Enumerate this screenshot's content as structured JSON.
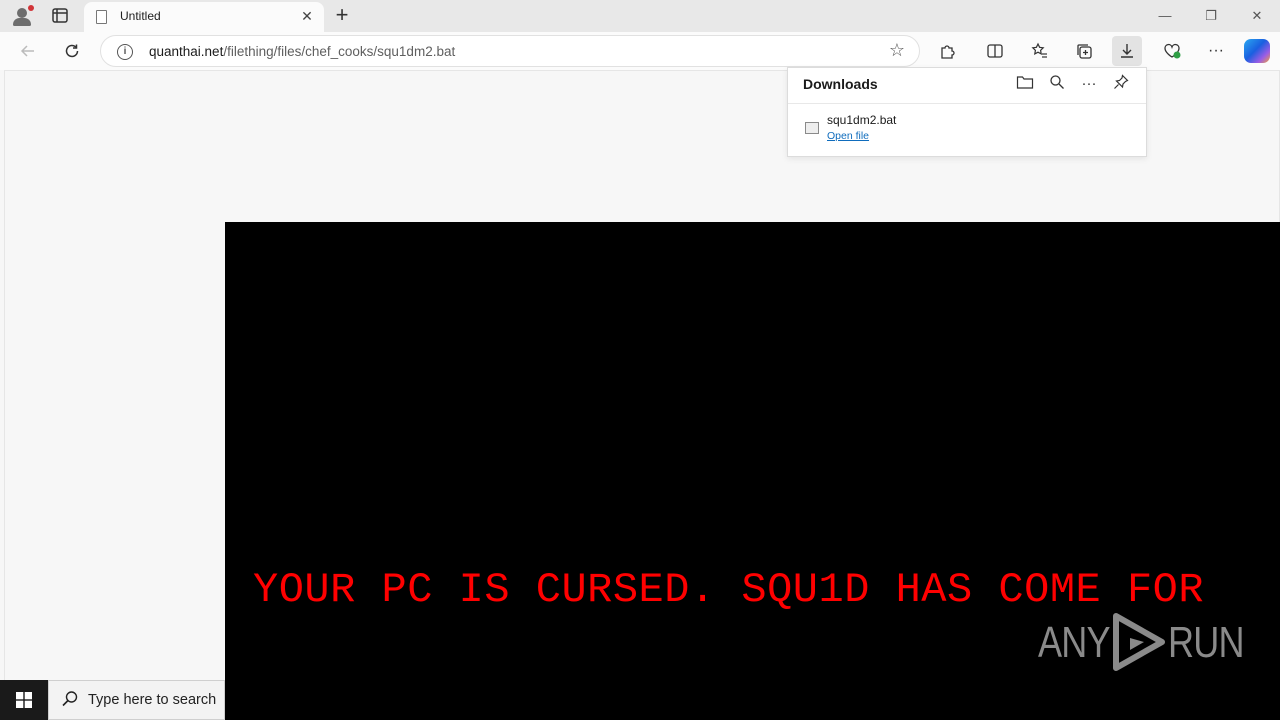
{
  "tab": {
    "title": "Untitled",
    "close": "✕",
    "new_tab": "+"
  },
  "window_controls": {
    "minimize": "—",
    "restore": "❐",
    "close": "✕"
  },
  "address": {
    "host": "quanthai.net",
    "path": "/filething/files/chef_cooks/squ1dm2.bat"
  },
  "downloads": {
    "title": "Downloads",
    "file_name": "squ1dm2.bat",
    "open_label": "Open file"
  },
  "console": {
    "message": "YOUR PC IS CURSED. SQU1D HAS COME FOR"
  },
  "watermark": {
    "left": "ANY",
    "right": "RUN"
  },
  "taskbar": {
    "search_placeholder": "Type here to search"
  },
  "colors": {
    "console_text": "#ff0000",
    "console_bg": "#000000",
    "link": "#0f6cbd"
  }
}
